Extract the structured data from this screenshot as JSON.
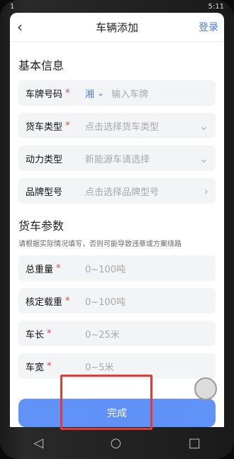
{
  "status_bar": {
    "left": "1",
    "right": "5:11"
  },
  "header": {
    "title": "车辆添加",
    "login_label": "登录",
    "back_icon": "back-arrow-icon"
  },
  "sections": {
    "basic_title": "基本信息",
    "truck_params_title": "货车参数",
    "truck_params_hint": "请根据实际情况填写，否则可能导致违章或方案绕路"
  },
  "basic_info": {
    "plate": {
      "label": "车牌号码",
      "required": true,
      "province": "湘",
      "placeholder": "输入车牌"
    },
    "truck_type": {
      "label": "货车类型",
      "required": true,
      "placeholder": "点击选择货车类型"
    },
    "power_type": {
      "label": "动力类型",
      "required": false,
      "placeholder": "新能源车请选择"
    },
    "brand_model": {
      "label": "品牌型号",
      "required": false,
      "placeholder": "点击选择品牌型号"
    }
  },
  "truck_params": [
    {
      "label": "总重量",
      "required": true,
      "placeholder": "0~100吨"
    },
    {
      "label": "核定载重",
      "required": true,
      "placeholder": "0~100吨"
    },
    {
      "label": "车长",
      "required": true,
      "placeholder": "0~25米"
    },
    {
      "label": "车宽",
      "required": true,
      "placeholder": "0~5米"
    }
  ],
  "footer": {
    "submit_label": "完成"
  },
  "nav": {
    "back": "◁",
    "home": "○",
    "recent": "□"
  },
  "colors": {
    "accent": "#4b7bec",
    "button": "#4f86f7",
    "required": "#e64646",
    "highlight": "#e53935"
  }
}
